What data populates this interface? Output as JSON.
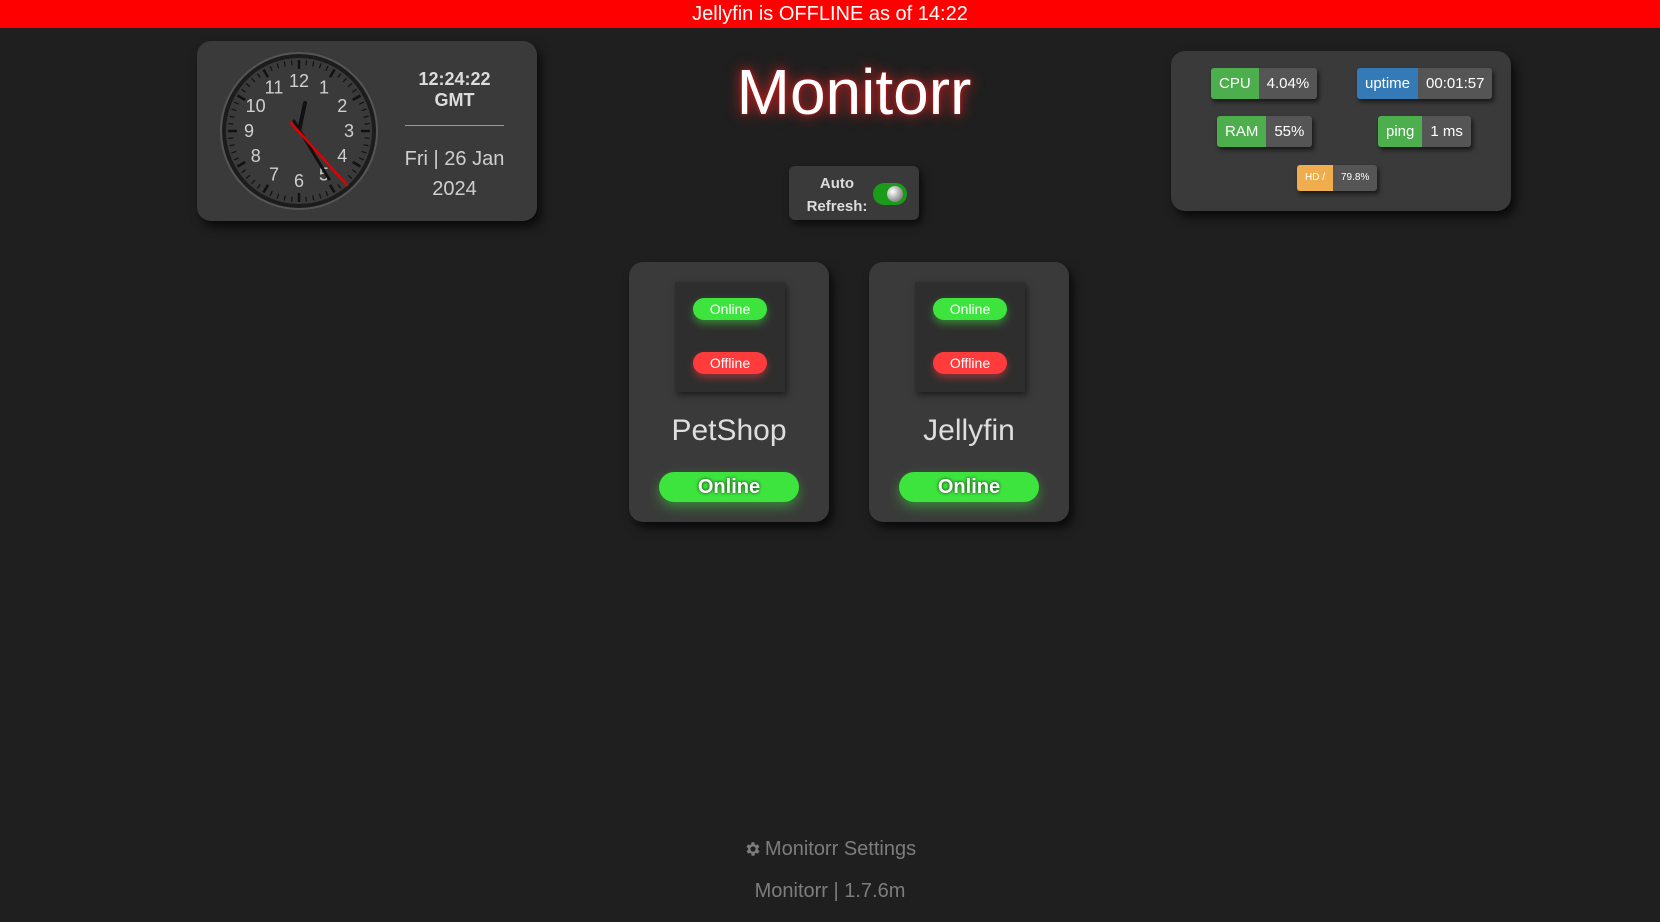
{
  "banner": {
    "text": "Jellyfin is OFFLINE as of 14:22",
    "color": "#ff0000"
  },
  "clock": {
    "time": "12:24:22 GMT",
    "date_line1": "Fri | 26 Jan",
    "date_line2": "2024",
    "numbers": [
      "12",
      "1",
      "2",
      "3",
      "4",
      "5",
      "6",
      "7",
      "8",
      "9",
      "10",
      "11"
    ]
  },
  "header": {
    "title": "Monitorr"
  },
  "auto_refresh": {
    "label_line1": "Auto",
    "label_line2": "Refresh:",
    "enabled": true
  },
  "stats": {
    "cpu": {
      "label": "CPU",
      "value": "4.04%"
    },
    "uptime": {
      "label": "uptime",
      "value": "00:01:57"
    },
    "ram": {
      "label": "RAM",
      "value": "55%"
    },
    "ping": {
      "label": "ping",
      "value": "1 ms"
    },
    "hd": {
      "label": "HD /",
      "value": "79.8%"
    }
  },
  "services": [
    {
      "name": "PetShop",
      "logo_online": "Online",
      "logo_offline": "Offline",
      "status": "Online"
    },
    {
      "name": "Jellyfin",
      "logo_online": "Online",
      "logo_offline": "Offline",
      "status": "Online"
    }
  ],
  "footer": {
    "settings_label": "Monitorr Settings",
    "version": "Monitorr | 1.7.6m"
  },
  "colors": {
    "online": "#3ee43e",
    "offline": "#ff3b3b",
    "accent": "#ff0000"
  }
}
